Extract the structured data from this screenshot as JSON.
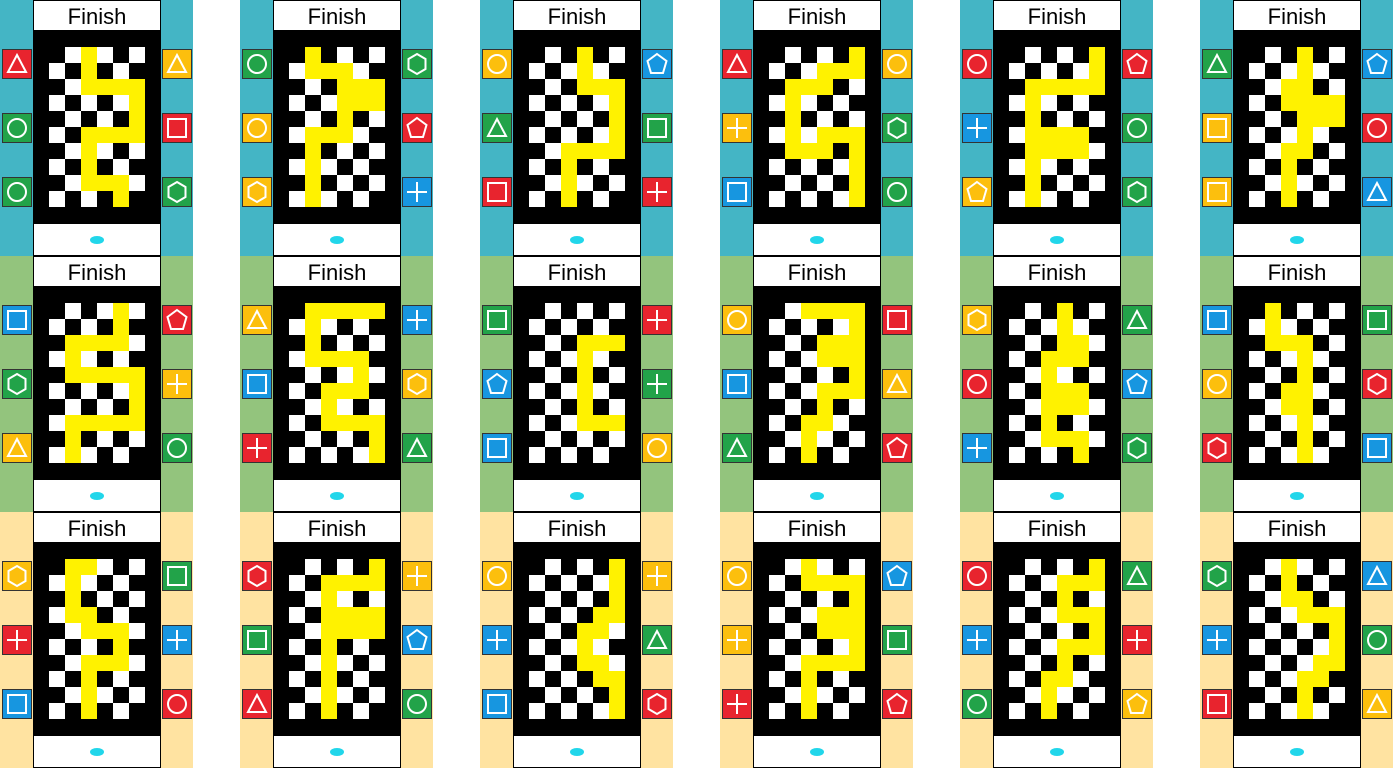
{
  "finish_label": "Finish",
  "row_colors": [
    "#44b5c5",
    "#93c47d",
    "#ffe3a1"
  ],
  "token_colors": {
    "red": "#e8242e",
    "green": "#22a349",
    "yellow": "#fcbf0d",
    "blue": "#1796e0"
  },
  "icons": [
    "triangle-icon",
    "circle-icon",
    "square-icon",
    "hexagon-icon",
    "pentagon-icon",
    "plus-icon"
  ],
  "start_marker": "cyan-diamond",
  "cards": [
    [
      {
        "left": [
          [
            "triangle",
            "red"
          ],
          [
            "circle",
            "green"
          ],
          [
            "circle",
            "green"
          ]
        ],
        "right": [
          [
            "triangle",
            "yellow"
          ],
          [
            "square",
            "red"
          ],
          [
            "hexagon",
            "green"
          ]
        ]
      },
      {
        "left": [
          [
            "circle",
            "green"
          ],
          [
            "circle",
            "yellow"
          ],
          [
            "hexagon",
            "yellow"
          ]
        ],
        "right": [
          [
            "hexagon",
            "green"
          ],
          [
            "pentagon",
            "red"
          ],
          [
            "plus",
            "blue"
          ]
        ]
      },
      {
        "left": [
          [
            "circle",
            "yellow"
          ],
          [
            "triangle",
            "green"
          ],
          [
            "square",
            "red"
          ]
        ],
        "right": [
          [
            "pentagon",
            "blue"
          ],
          [
            "square",
            "green"
          ],
          [
            "plus",
            "red"
          ]
        ]
      },
      {
        "left": [
          [
            "triangle",
            "red"
          ],
          [
            "plus",
            "yellow"
          ],
          [
            "square",
            "blue"
          ]
        ],
        "right": [
          [
            "circle",
            "yellow"
          ],
          [
            "hexagon",
            "green"
          ],
          [
            "circle",
            "green"
          ]
        ]
      },
      {
        "left": [
          [
            "circle",
            "red"
          ],
          [
            "plus",
            "blue"
          ],
          [
            "pentagon",
            "yellow"
          ]
        ],
        "right": [
          [
            "pentagon",
            "red"
          ],
          [
            "circle",
            "green"
          ],
          [
            "hexagon",
            "green"
          ]
        ]
      },
      {
        "left": [
          [
            "triangle",
            "green"
          ],
          [
            "square",
            "yellow"
          ],
          [
            "square",
            "yellow"
          ]
        ],
        "right": [
          [
            "pentagon",
            "blue"
          ],
          [
            "circle",
            "red"
          ],
          [
            "triangle",
            "blue"
          ]
        ]
      }
    ],
    [
      {
        "left": [
          [
            "square",
            "blue"
          ],
          [
            "hexagon",
            "green"
          ],
          [
            "triangle",
            "yellow"
          ]
        ],
        "right": [
          [
            "pentagon",
            "red"
          ],
          [
            "plus",
            "yellow"
          ],
          [
            "circle",
            "green"
          ]
        ]
      },
      {
        "left": [
          [
            "triangle",
            "yellow"
          ],
          [
            "square",
            "blue"
          ],
          [
            "plus",
            "red"
          ]
        ],
        "right": [
          [
            "plus",
            "blue"
          ],
          [
            "hexagon",
            "yellow"
          ],
          [
            "triangle",
            "green"
          ]
        ]
      },
      {
        "left": [
          [
            "square",
            "green"
          ],
          [
            "pentagon",
            "blue"
          ],
          [
            "square",
            "blue"
          ]
        ],
        "right": [
          [
            "plus",
            "red"
          ],
          [
            "plus",
            "green"
          ],
          [
            "circle",
            "yellow"
          ]
        ]
      },
      {
        "left": [
          [
            "circle",
            "yellow"
          ],
          [
            "square",
            "blue"
          ],
          [
            "triangle",
            "green"
          ]
        ],
        "right": [
          [
            "square",
            "red"
          ],
          [
            "triangle",
            "yellow"
          ],
          [
            "pentagon",
            "red"
          ]
        ]
      },
      {
        "left": [
          [
            "hexagon",
            "yellow"
          ],
          [
            "circle",
            "red"
          ],
          [
            "plus",
            "blue"
          ]
        ],
        "right": [
          [
            "triangle",
            "green"
          ],
          [
            "pentagon",
            "blue"
          ],
          [
            "hexagon",
            "green"
          ]
        ]
      },
      {
        "left": [
          [
            "square",
            "blue"
          ],
          [
            "circle",
            "yellow"
          ],
          [
            "hexagon",
            "red"
          ]
        ],
        "right": [
          [
            "square",
            "green"
          ],
          [
            "hexagon",
            "red"
          ],
          [
            "square",
            "blue"
          ]
        ]
      }
    ],
    [
      {
        "left": [
          [
            "hexagon",
            "yellow"
          ],
          [
            "plus",
            "red"
          ],
          [
            "square",
            "blue"
          ]
        ],
        "right": [
          [
            "square",
            "green"
          ],
          [
            "plus",
            "blue"
          ],
          [
            "circle",
            "red"
          ]
        ]
      },
      {
        "left": [
          [
            "hexagon",
            "red"
          ],
          [
            "square",
            "green"
          ],
          [
            "triangle",
            "red"
          ]
        ],
        "right": [
          [
            "plus",
            "yellow"
          ],
          [
            "pentagon",
            "blue"
          ],
          [
            "circle",
            "green"
          ]
        ]
      },
      {
        "left": [
          [
            "circle",
            "yellow"
          ],
          [
            "plus",
            "blue"
          ],
          [
            "square",
            "blue"
          ]
        ],
        "right": [
          [
            "plus",
            "yellow"
          ],
          [
            "triangle",
            "green"
          ],
          [
            "hexagon",
            "red"
          ]
        ]
      },
      {
        "left": [
          [
            "circle",
            "yellow"
          ],
          [
            "plus",
            "yellow"
          ],
          [
            "plus",
            "red"
          ]
        ],
        "right": [
          [
            "pentagon",
            "blue"
          ],
          [
            "square",
            "green"
          ],
          [
            "pentagon",
            "red"
          ]
        ]
      },
      {
        "left": [
          [
            "circle",
            "red"
          ],
          [
            "plus",
            "blue"
          ],
          [
            "circle",
            "green"
          ]
        ],
        "right": [
          [
            "triangle",
            "green"
          ],
          [
            "plus",
            "red"
          ],
          [
            "pentagon",
            "yellow"
          ]
        ]
      },
      {
        "left": [
          [
            "hexagon",
            "green"
          ],
          [
            "plus",
            "blue"
          ],
          [
            "square",
            "red"
          ]
        ],
        "right": [
          [
            "triangle",
            "blue"
          ],
          [
            "circle",
            "green"
          ],
          [
            "triangle",
            "yellow"
          ]
        ]
      }
    ]
  ]
}
